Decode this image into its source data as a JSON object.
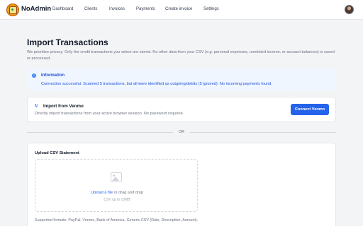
{
  "header": {
    "brand": "NoAdmin",
    "nav": [
      "Dashboard",
      "Clients",
      "Invoices",
      "Payments",
      "Create invoice",
      "Settings"
    ]
  },
  "page": {
    "title": "Import Transactions",
    "privacy_note": "We prioritize privacy. Only the credit transactions you select are stored. No other data from your CSV (e.g. personal expenses, unrelated income, or account balances) is saved or processed."
  },
  "info": {
    "title": "Information",
    "message": "Connection successful. Scanned 5 transactions, but all were identified as outgoing/debits (5 ignored). No incoming payments found."
  },
  "venmo": {
    "title": "Import from Venmo",
    "description": "Directly import transactions from your active browser session. No password required.",
    "button": "Connect Venmo"
  },
  "divider": {
    "label": "OR"
  },
  "upload": {
    "label": "Upload CSV Statement",
    "link_text": "Upload a file",
    "suffix_text": " or drag and drop",
    "limit": "CSV up to 10MB",
    "formats": "Supported formats: PayPal, Venmo, Bank of America, Generic CSV (Date, Description, Amount)."
  },
  "colors": {
    "primary": "#2563eb",
    "info_bg": "#eff6ff",
    "info_text": "#1d4ed8"
  }
}
